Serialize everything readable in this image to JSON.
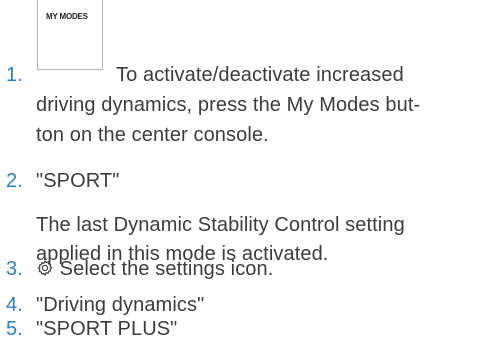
{
  "steps": [
    {
      "number": "1.",
      "button_image_label": "MY MODES",
      "lines": [
        "To activate/deactivate increased",
        "driving dynamics, press the My Modes but-",
        "ton on the center console."
      ]
    },
    {
      "number": "2.",
      "lines": [
        "\"SPORT\""
      ],
      "note_lines": [
        "The last Dynamic Stability Control setting",
        "applied in this mode is activated."
      ]
    },
    {
      "number": "3.",
      "icon": "gear-icon",
      "lines": [
        "Select the settings icon."
      ]
    },
    {
      "number": "4.",
      "lines": [
        "\"Driving dynamics\""
      ]
    },
    {
      "number": "5.",
      "lines": [
        "\"SPORT PLUS\""
      ]
    }
  ],
  "colors": {
    "number": "#2b80c5",
    "text": "#3c3c3c"
  }
}
